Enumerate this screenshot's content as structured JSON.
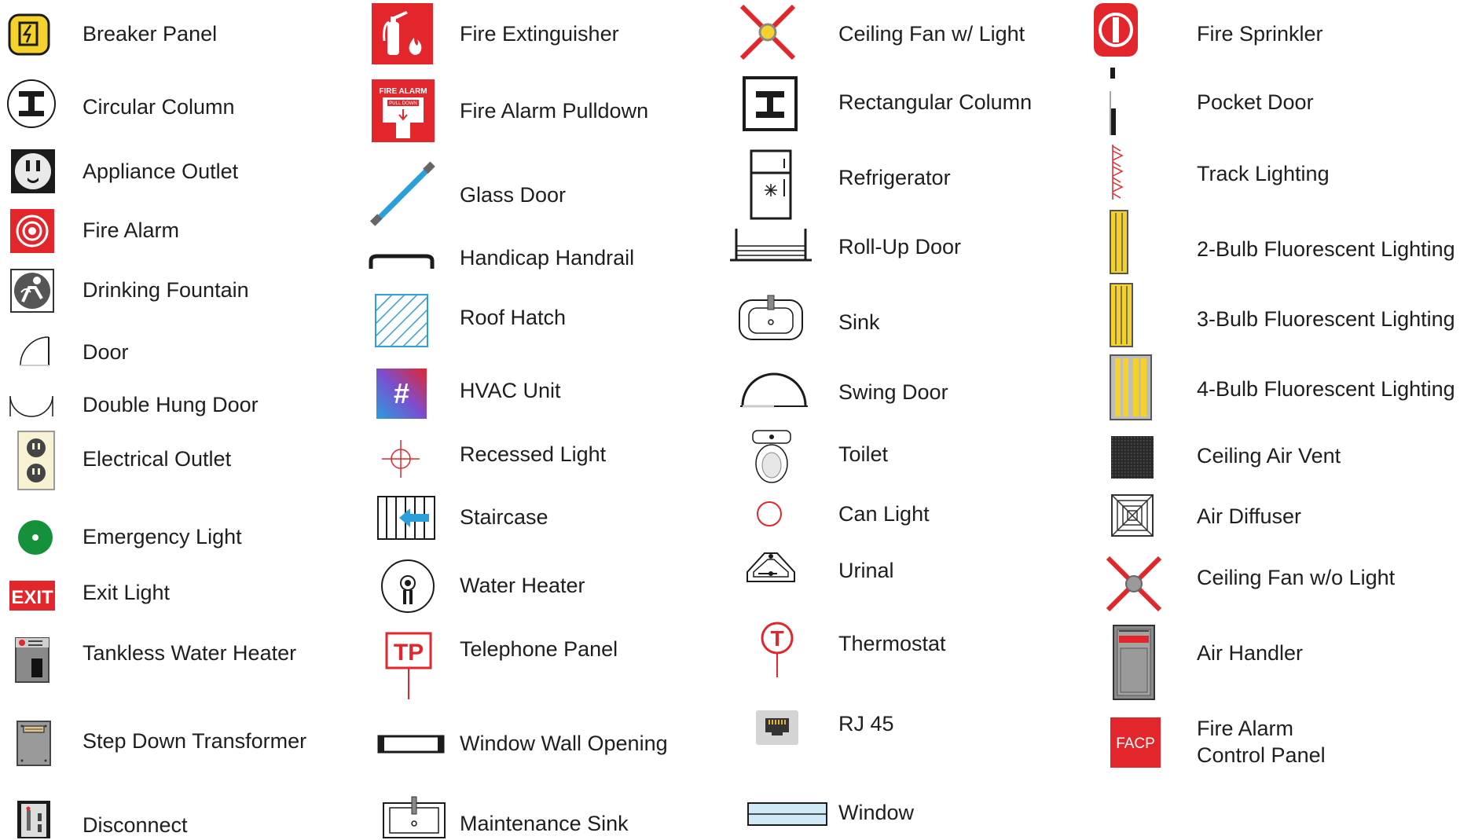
{
  "legend": {
    "col1": [
      {
        "label": "Breaker Panel",
        "icon": "breaker-panel-icon"
      },
      {
        "label": "Circular Column",
        "icon": "circular-column-icon"
      },
      {
        "label": "Appliance Outlet",
        "icon": "appliance-outlet-icon"
      },
      {
        "label": "Fire Alarm",
        "icon": "fire-alarm-icon"
      },
      {
        "label": "Drinking Fountain",
        "icon": "drinking-fountain-icon"
      },
      {
        "label": "Door",
        "icon": "door-icon"
      },
      {
        "label": "Double Hung Door",
        "icon": "double-hung-door-icon"
      },
      {
        "label": "Electrical Outlet",
        "icon": "electrical-outlet-icon"
      },
      {
        "label": "Emergency Light",
        "icon": "emergency-light-icon"
      },
      {
        "label": "Exit Light",
        "icon": "exit-light-icon",
        "icon_text": "EXIT"
      },
      {
        "label": "Tankless Water Heater",
        "icon": "tankless-water-heater-icon"
      },
      {
        "label": "Step Down Transformer",
        "icon": "step-down-transformer-icon"
      },
      {
        "label": "Disconnect",
        "icon": "disconnect-icon"
      }
    ],
    "col2": [
      {
        "label": "Fire Extinguisher",
        "icon": "fire-extinguisher-icon"
      },
      {
        "label": "Fire Alarm Pulldown",
        "icon": "fire-alarm-pulldown-icon",
        "icon_text": "FIRE ALARM",
        "icon_subtext": "PULL DOWN"
      },
      {
        "label": "Glass Door",
        "icon": "glass-door-icon"
      },
      {
        "label": "Handicap Handrail",
        "icon": "handicap-handrail-icon"
      },
      {
        "label": "Roof Hatch",
        "icon": "roof-hatch-icon"
      },
      {
        "label": "HVAC Unit",
        "icon": "hvac-unit-icon",
        "icon_text": "#"
      },
      {
        "label": "Recessed Light",
        "icon": "recessed-light-icon"
      },
      {
        "label": "Staircase",
        "icon": "staircase-icon"
      },
      {
        "label": "Water Heater",
        "icon": "water-heater-icon"
      },
      {
        "label": "Telephone Panel",
        "icon": "telephone-panel-icon",
        "icon_text": "TP"
      },
      {
        "label": "Window Wall Opening",
        "icon": "window-wall-opening-icon"
      },
      {
        "label": "Maintenance Sink",
        "icon": "maintenance-sink-icon"
      }
    ],
    "col3": [
      {
        "label": "Ceiling Fan w/ Light",
        "icon": "ceiling-fan-with-light-icon"
      },
      {
        "label": "Rectangular Column",
        "icon": "rectangular-column-icon"
      },
      {
        "label": "Refrigerator",
        "icon": "refrigerator-icon"
      },
      {
        "label": "Roll-Up Door",
        "icon": "roll-up-door-icon"
      },
      {
        "label": "Sink",
        "icon": "sink-icon"
      },
      {
        "label": "Swing Door",
        "icon": "swing-door-icon"
      },
      {
        "label": "Toilet",
        "icon": "toilet-icon"
      },
      {
        "label": "Can Light",
        "icon": "can-light-icon"
      },
      {
        "label": "Urinal",
        "icon": "urinal-icon"
      },
      {
        "label": "Thermostat",
        "icon": "thermostat-icon",
        "icon_text": "T"
      },
      {
        "label": "RJ 45",
        "icon": "rj45-icon"
      },
      {
        "label": "Window",
        "icon": "window-icon"
      }
    ],
    "col4": [
      {
        "label": "Fire Sprinkler",
        "icon": "fire-sprinkler-icon"
      },
      {
        "label": "Pocket Door",
        "icon": "pocket-door-icon"
      },
      {
        "label": "Track Lighting",
        "icon": "track-lighting-icon"
      },
      {
        "label": "2-Bulb Fluorescent Lighting",
        "icon": "two-bulb-fluorescent-icon"
      },
      {
        "label": "3-Bulb Fluorescent Lighting",
        "icon": "three-bulb-fluorescent-icon"
      },
      {
        "label": "4-Bulb Fluorescent Lighting",
        "icon": "four-bulb-fluorescent-icon"
      },
      {
        "label": "Ceiling Air Vent",
        "icon": "ceiling-air-vent-icon"
      },
      {
        "label": "Air Diffuser",
        "icon": "air-diffuser-icon"
      },
      {
        "label": "Ceiling Fan w/o Light",
        "icon": "ceiling-fan-without-light-icon"
      },
      {
        "label": "Air Handler",
        "icon": "air-handler-icon"
      },
      {
        "label": "Fire Alarm",
        "label_line2": "Control Panel",
        "icon": "fire-alarm-control-panel-icon",
        "icon_text": "FACP"
      }
    ]
  },
  "colors": {
    "red": "#e3262b",
    "yellow": "#f4d22b",
    "green": "#15913c",
    "blue": "#2a9fdb",
    "gray": "#8a8a8a",
    "dark": "#1b1b1b"
  }
}
